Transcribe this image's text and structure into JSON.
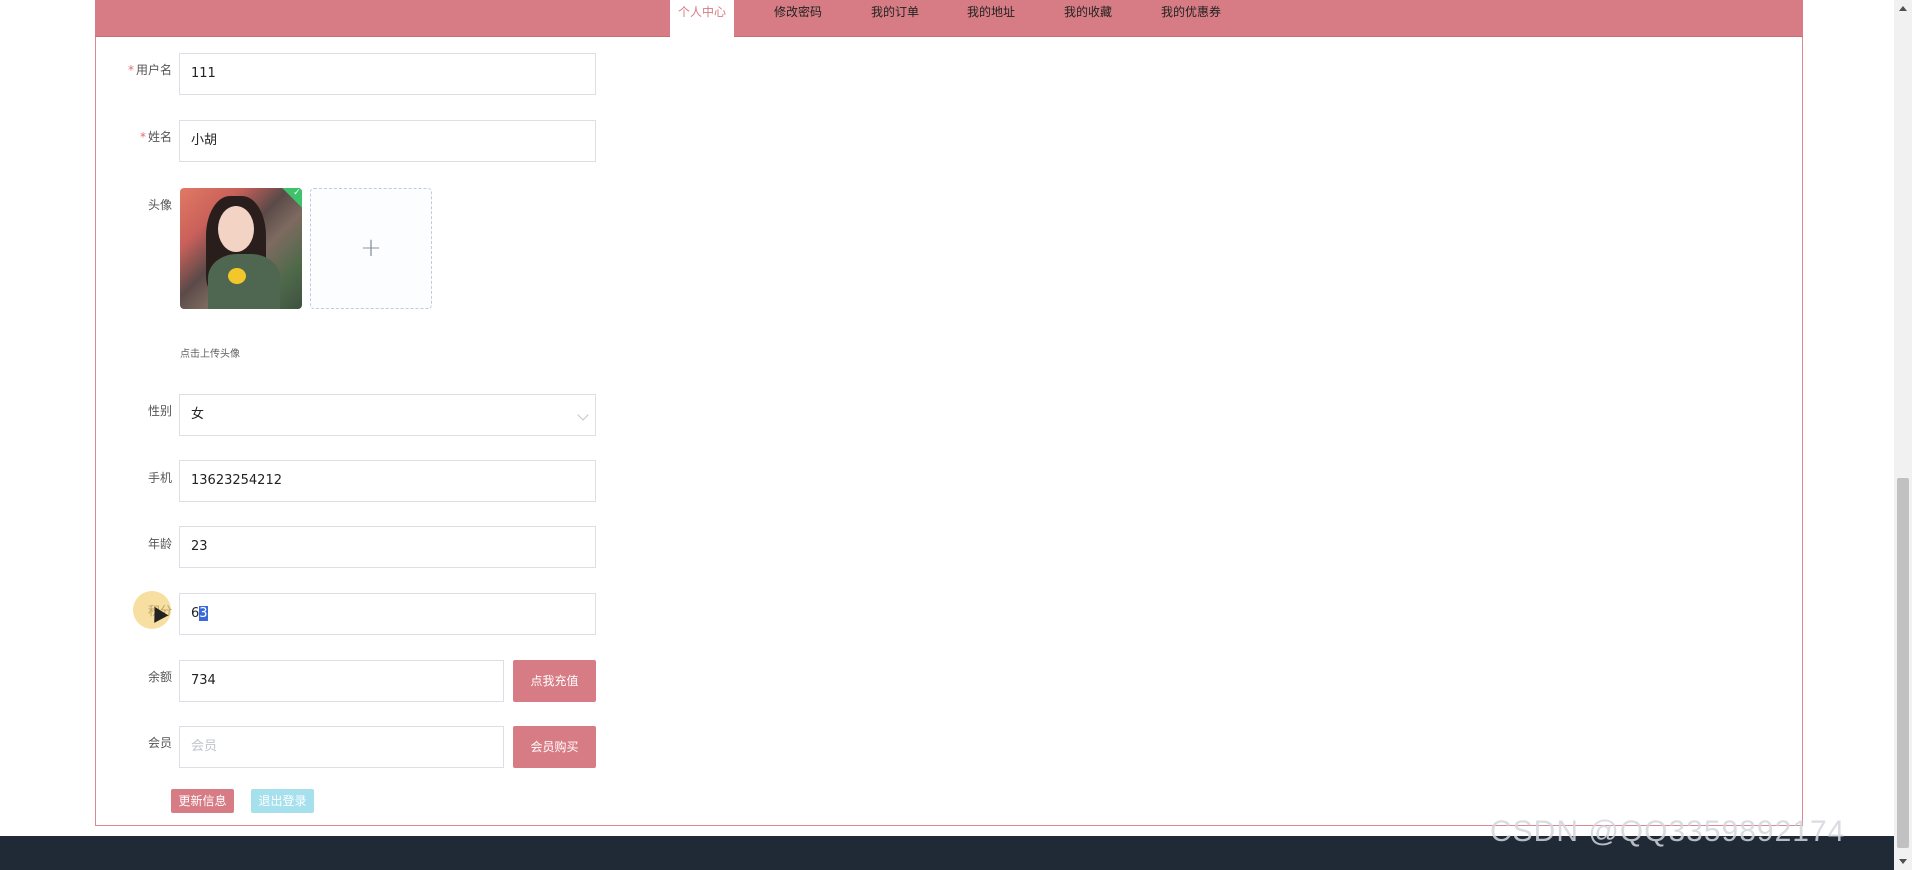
{
  "nav": {
    "tabs": [
      {
        "label": "个人中心",
        "active": true
      },
      {
        "label": "修改密码",
        "active": false
      },
      {
        "label": "我的订单",
        "active": false
      },
      {
        "label": "我的地址",
        "active": false
      },
      {
        "label": "我的收藏",
        "active": false
      },
      {
        "label": "我的优惠券",
        "active": false
      }
    ]
  },
  "form": {
    "username": {
      "label": "用户名",
      "required": "*",
      "value": "111"
    },
    "name": {
      "label": "姓名",
      "required": "*",
      "value": "小胡"
    },
    "avatar": {
      "label": "头像",
      "upload_plus": "+",
      "hint": "点击上传头像",
      "uploaded_check": "✓"
    },
    "gender": {
      "label": "性别",
      "value": "女"
    },
    "phone": {
      "label": "手机",
      "value": "13623254212"
    },
    "age": {
      "label": "年龄",
      "value": "23"
    },
    "points": {
      "label": "积分",
      "value_part1": "6",
      "value_part2": "3"
    },
    "balance": {
      "label": "余额",
      "value": "734",
      "button": "点我充值"
    },
    "member": {
      "label": "会员",
      "placeholder": "会员",
      "button": "会员购买"
    }
  },
  "actions": {
    "update": "更新信息",
    "logout": "退出登录"
  },
  "watermark": "CSDN @QQ3359892174",
  "colors": {
    "accent": "#d77c84",
    "secondary": "#a6e0ec",
    "footer": "#1f2a36"
  }
}
